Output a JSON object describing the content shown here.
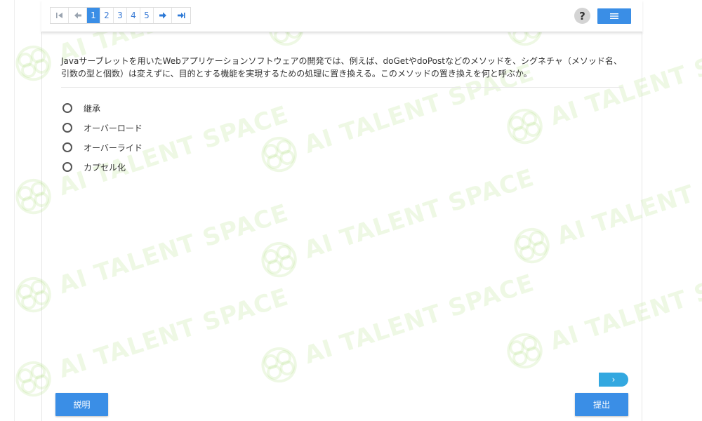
{
  "watermark": {
    "text": "AI TALENT SPACE",
    "color": "#aadc78"
  },
  "toolbar": {
    "pager": {
      "first_icon": "first-page-icon",
      "prev_icon": "prev-page-icon",
      "pages": [
        "1",
        "2",
        "3",
        "4",
        "5"
      ],
      "current_page": "1",
      "next_icon": "next-page-icon",
      "last_icon": "last-page-icon"
    },
    "help_label": "?",
    "menu_icon": "menu-list-icon"
  },
  "question": {
    "line1": "Javaサーブレットを用いたWebアプリケーションソフトウェアの開発では、例えば、doGetやdoPostなどのメソッドを、シグネチャ（メソッド名、",
    "line2": "引数の型と個数）は変えずに、目的とする機能を実現するための処理に置き換える。このメソッドの置き換えを何と呼ぶか。"
  },
  "options": [
    {
      "label": "継承"
    },
    {
      "label": "オーバーロード"
    },
    {
      "label": "オーバーライド"
    },
    {
      "label": "カプセル化"
    }
  ],
  "footer": {
    "next_tab_label": "›",
    "explain_label": "説明",
    "submit_label": "提出"
  },
  "colors": {
    "primary": "#3a8ee6",
    "next_tab": "#33a8e0",
    "help_bg": "#d4d4d4"
  }
}
